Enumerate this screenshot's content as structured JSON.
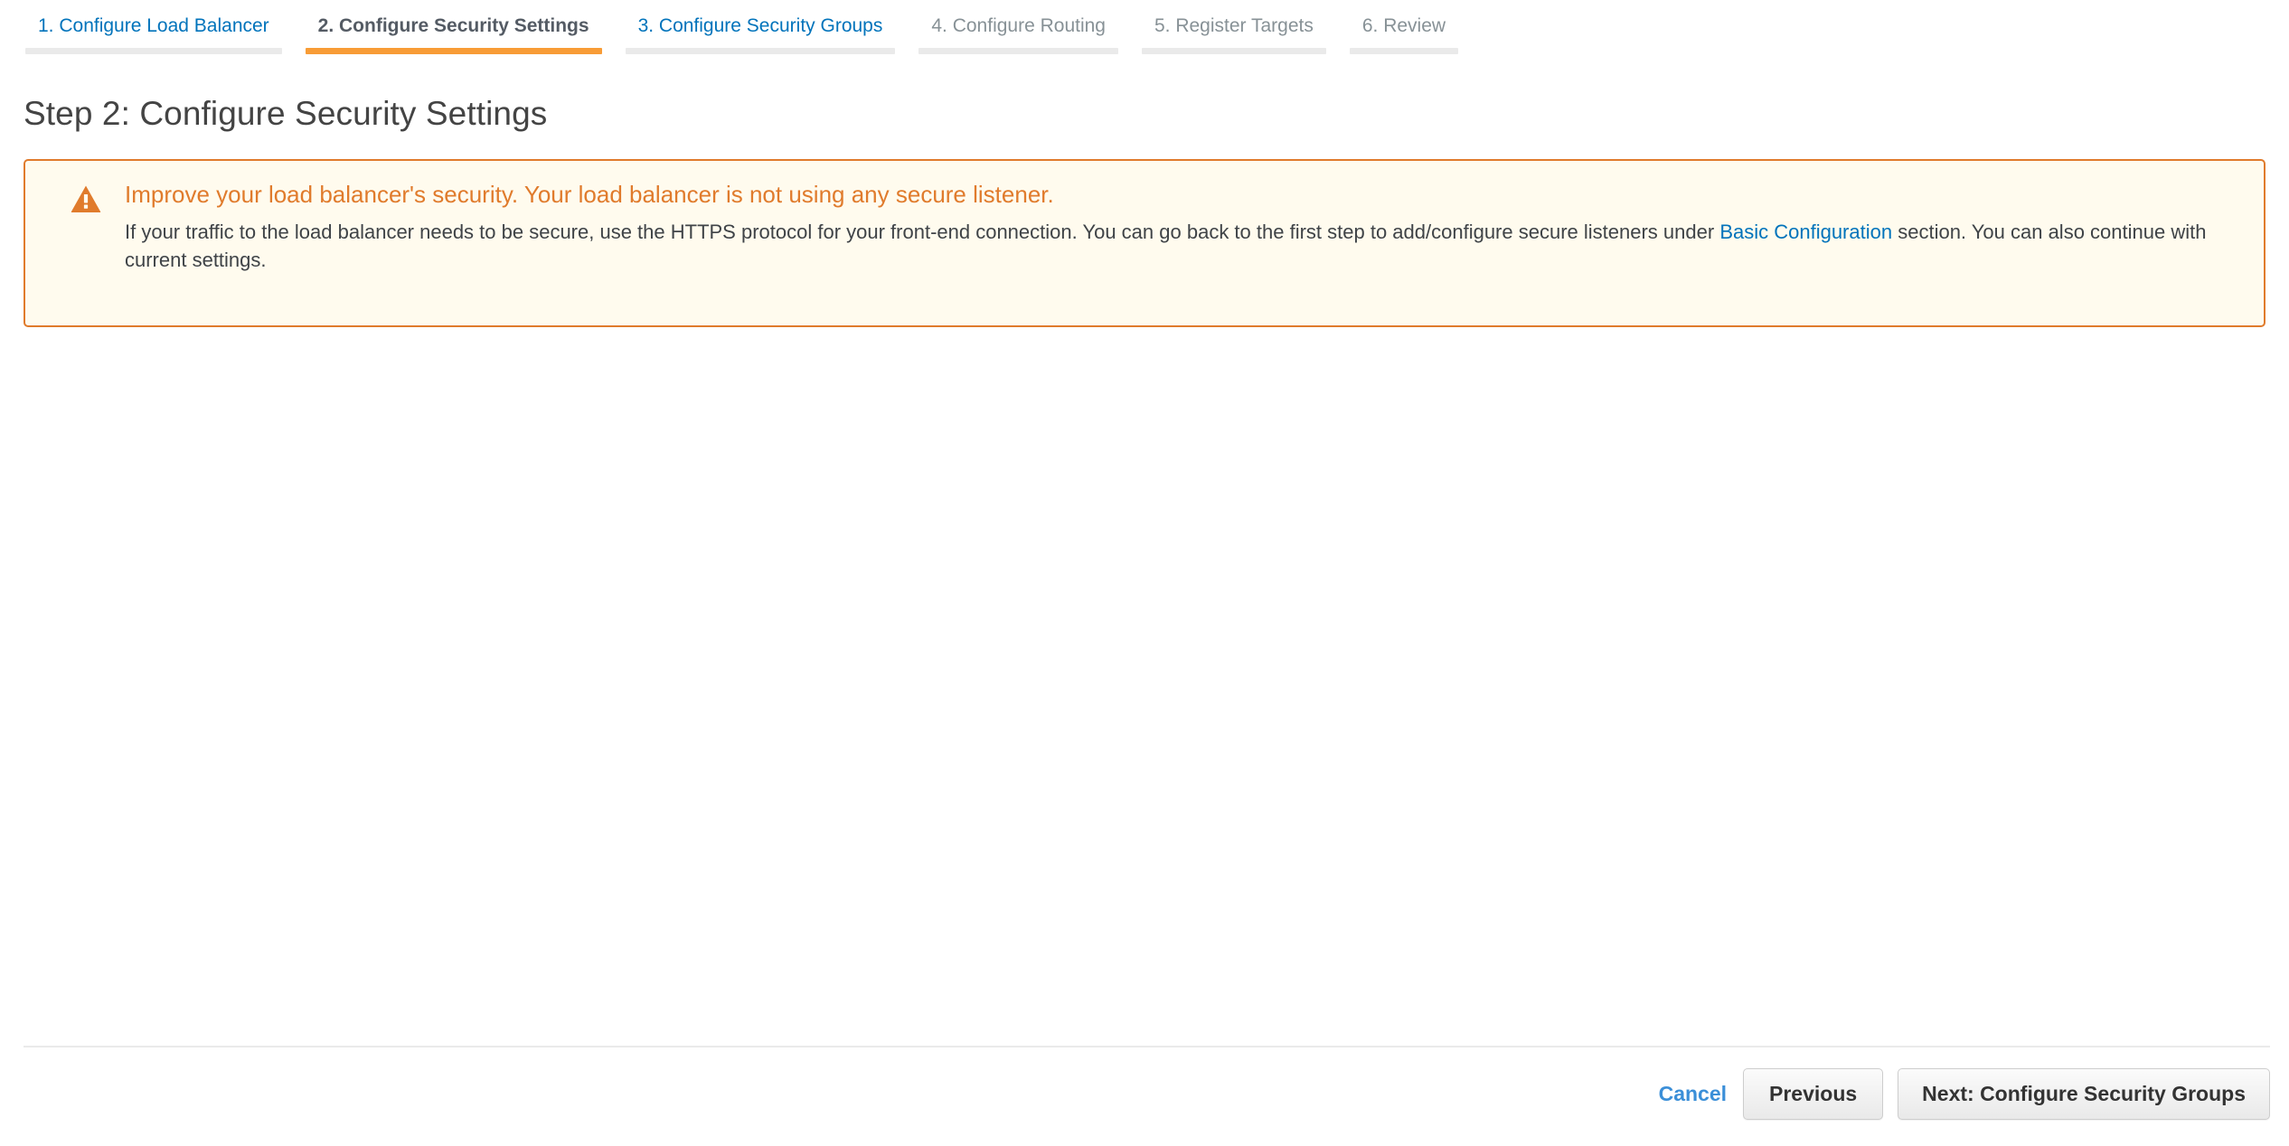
{
  "wizard": {
    "tabs": [
      {
        "label": "1. Configure Load Balancer",
        "state": "link",
        "name": "tab-configure-load-balancer"
      },
      {
        "label": "2. Configure Security Settings",
        "state": "active",
        "name": "tab-configure-security-settings"
      },
      {
        "label": "3. Configure Security Groups",
        "state": "link",
        "name": "tab-configure-security-groups"
      },
      {
        "label": "4. Configure Routing",
        "state": "disabled",
        "name": "tab-configure-routing"
      },
      {
        "label": "5. Register Targets",
        "state": "disabled",
        "name": "tab-register-targets"
      },
      {
        "label": "6. Review",
        "state": "disabled",
        "name": "tab-review"
      }
    ]
  },
  "page": {
    "title": "Step 2: Configure Security Settings"
  },
  "alert": {
    "icon": "warning-triangle-icon",
    "title": "Improve your load balancer's security. Your load balancer is not using any secure listener.",
    "body_part_1": "If your traffic to the load balancer needs to be secure, use the HTTPS protocol for your front-end connection. You can go back to the first step to add/configure secure listeners under",
    "link_label": "Basic Configuration",
    "body_part_2": "section. You can also continue with current settings."
  },
  "footer": {
    "cancel_label": "Cancel",
    "previous_label": "Previous",
    "next_label": "Next: Configure Security Groups"
  },
  "colors": {
    "accent_orange": "#f89c36",
    "alert_border": "#e07b2c",
    "alert_background": "#fffbee",
    "link_blue": "#0073bb",
    "cancel_blue": "#3b8fd8",
    "tab_rule_grey": "#eaeaea"
  }
}
